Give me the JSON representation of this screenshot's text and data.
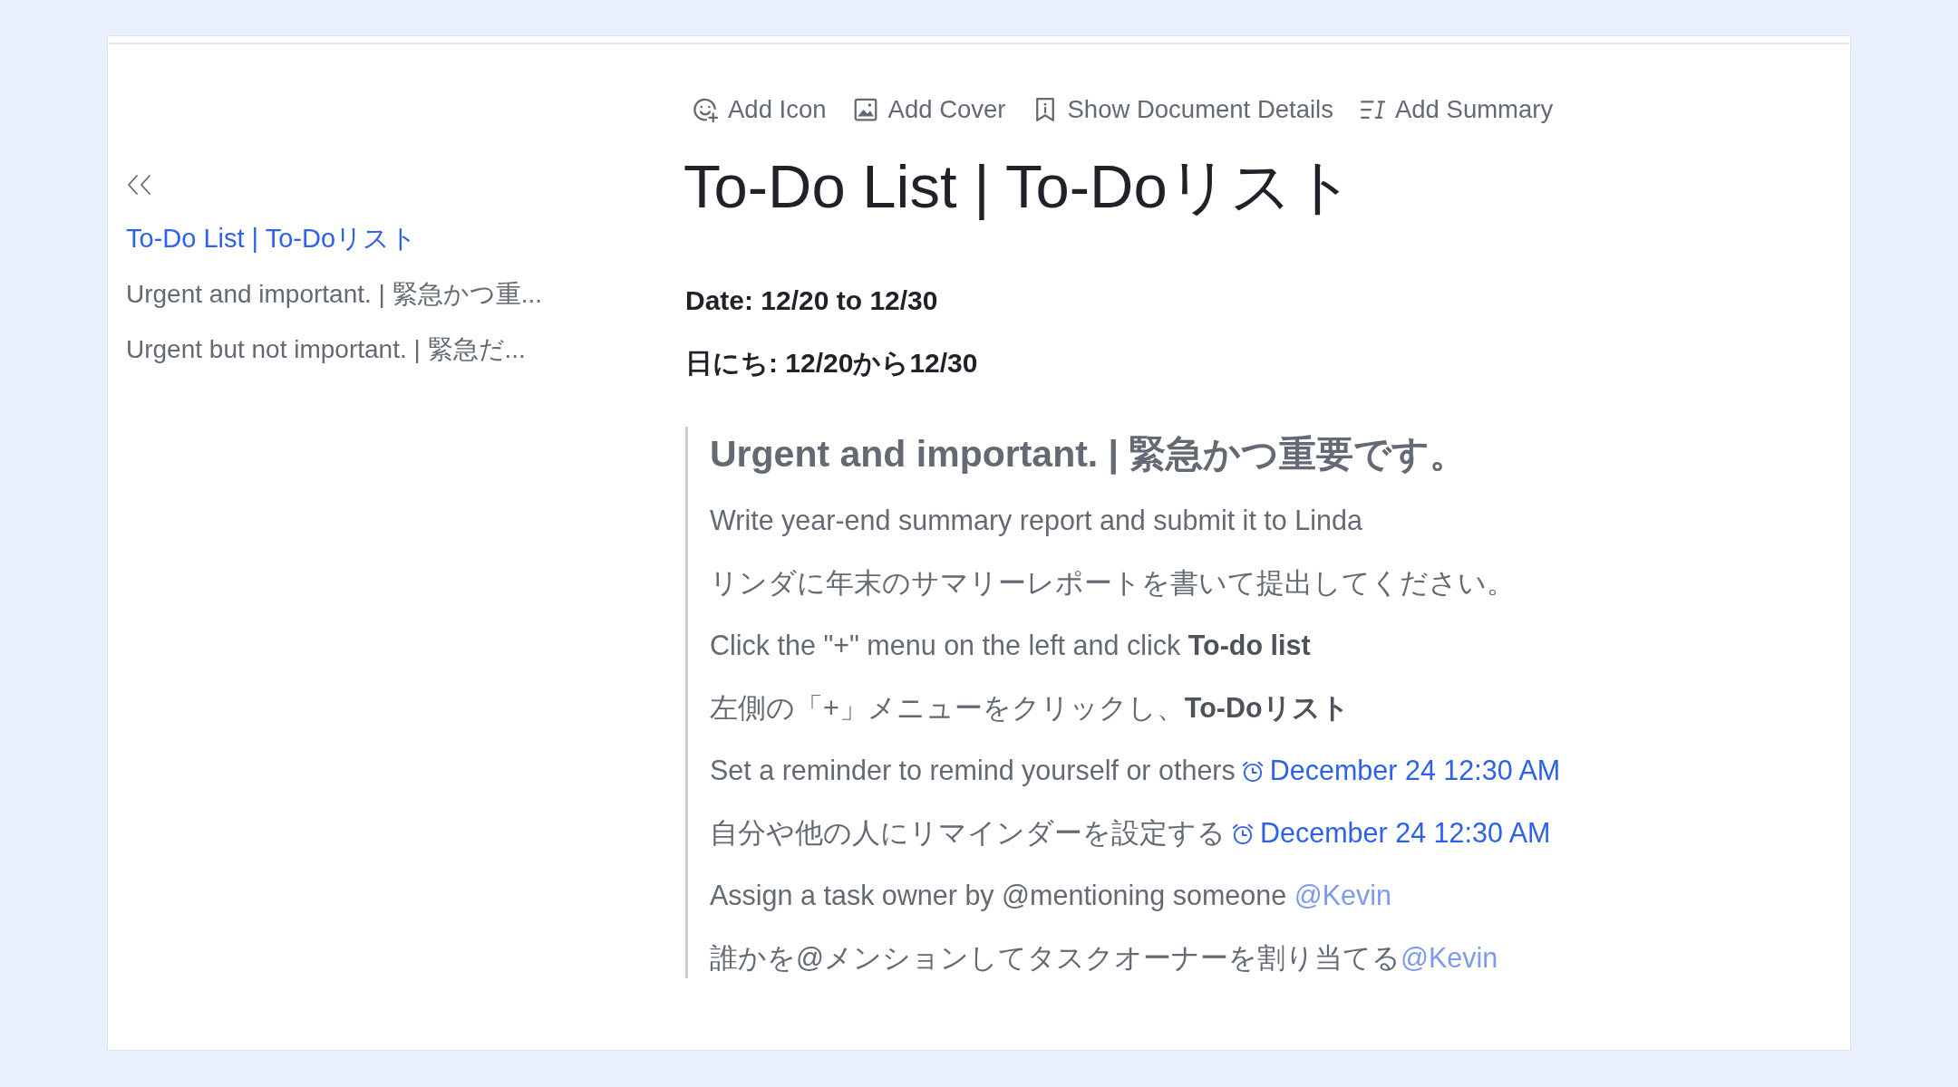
{
  "toolbar": [
    {
      "label": "Add Icon"
    },
    {
      "label": "Add Cover"
    },
    {
      "label": "Show Document Details"
    },
    {
      "label": "Add Summary"
    }
  ],
  "sidebar": {
    "items": [
      {
        "label": "To-Do List | To-Doリスト",
        "selected": true
      },
      {
        "label": "Urgent and important. | 緊急かつ重...",
        "selected": false
      },
      {
        "label": "Urgent but not important. | 緊急だ...",
        "selected": false
      }
    ]
  },
  "document": {
    "title": "To-Do List | To-Doリスト",
    "dates": [
      "Date: 12/20 to 12/30",
      "日にち: 12/20から12/30"
    ],
    "section": {
      "heading": "Urgent and important. | 緊急かつ重要です。",
      "lines": [
        {
          "kind": "text",
          "text": "Write year-end summary report and submit it to Linda"
        },
        {
          "kind": "text",
          "text": "リンダに年末のサマリーレポートを書いて提出してください。"
        },
        {
          "kind": "text",
          "text": "Click the \"+\" menu on the left and click **To-do list**"
        },
        {
          "kind": "text",
          "text": "左側の「+」メニューをクリックし、**To-Doリスト**"
        },
        {
          "kind": "reminder",
          "text": "Set a reminder to remind yourself or others",
          "reminder": "December 24 12:30 AM"
        },
        {
          "kind": "reminder",
          "text": "自分や他の人にリマインダーを設定する",
          "reminder": "December 24 12:30 AM"
        },
        {
          "kind": "mention",
          "text": "Assign a task owner by @mentioning someone ",
          "mention": "@Kevin"
        },
        {
          "kind": "mention",
          "text": "誰かを@メンションしてタスクオーナーを割り当てる",
          "mention": "@Kevin"
        }
      ]
    }
  }
}
